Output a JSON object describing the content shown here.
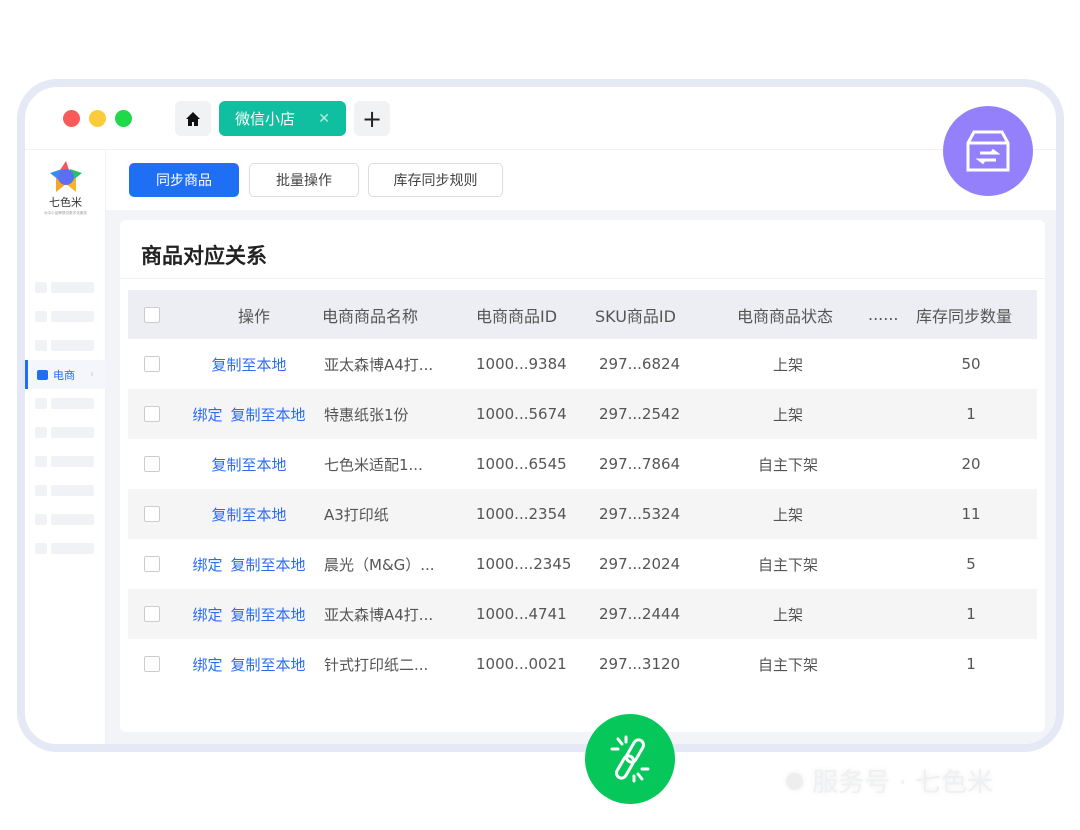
{
  "window": {
    "tab_label": "微信小店",
    "controls": [
      "close",
      "minimize",
      "maximize"
    ]
  },
  "brand": {
    "name": "七色米",
    "tagline": "为中小品牌提供数字化服务"
  },
  "sidebar": {
    "active_item": "电商"
  },
  "toolbar": {
    "sync": "同步商品",
    "batch": "批量操作",
    "rules": "库存同步规则"
  },
  "card": {
    "title": "商品对应关系"
  },
  "table": {
    "headers": [
      "操作",
      "电商商品名称",
      "电商商品ID",
      "SKU商品ID",
      "电商商品状态",
      "......",
      "库存同步数量"
    ],
    "bind_label": "绑定",
    "copy_label": "复制至本地",
    "rows": [
      {
        "bind": false,
        "name": "亚太森博A4打...",
        "id": "1000...9384",
        "sku": "297...6824",
        "status": "上架",
        "qty": "50"
      },
      {
        "bind": true,
        "name": "特惠纸张1份",
        "id": "1000...5674",
        "sku": "297...2542",
        "status": "上架",
        "qty": "1"
      },
      {
        "bind": false,
        "name": "七色米适配1...",
        "id": "1000...6545",
        "sku": "297...7864",
        "status": "自主下架",
        "qty": "20"
      },
      {
        "bind": false,
        "name": "A3打印纸",
        "id": "1000...2354",
        "sku": "297...5324",
        "status": "上架",
        "qty": "11"
      },
      {
        "bind": true,
        "name": "晨光（M&G）...",
        "id": "1000....2345",
        "sku": "297...2024",
        "status": "自主下架",
        "qty": "5"
      },
      {
        "bind": true,
        "name": "亚太森博A4打...",
        "id": "1000...4741",
        "sku": "297...2444",
        "status": "上架",
        "qty": "1"
      },
      {
        "bind": true,
        "name": "针式打印纸二...",
        "id": "1000...0021",
        "sku": "297...3120",
        "status": "自主下架",
        "qty": "1"
      }
    ]
  },
  "watermark": "服务号 · 七色米",
  "colors": {
    "primary": "#1f6ff5",
    "tab": "#0fbf9f",
    "purple": "#9580fb",
    "green": "#06c75a"
  }
}
